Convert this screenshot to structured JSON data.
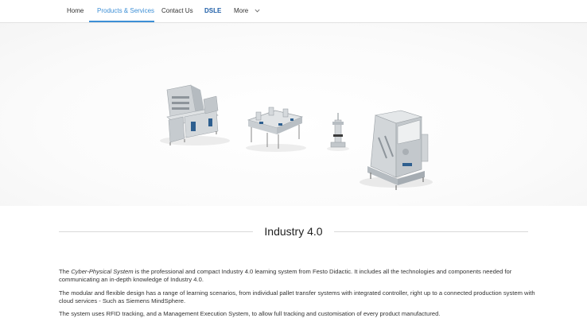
{
  "nav": {
    "items": [
      {
        "label": "Home",
        "active": false
      },
      {
        "label": "Products & Services",
        "active": true
      },
      {
        "label": "Contact Us",
        "active": false
      }
    ],
    "dsle": {
      "part1": "DS",
      "part2": "LE"
    },
    "more_label": "More",
    "more_icon": "chevron-down-icon",
    "accent_color": "#3d8fd6"
  },
  "hero": {
    "image_alt": "Cyber-Physical System production line machines"
  },
  "section": {
    "title": "Industry 4.0"
  },
  "content": {
    "p1_pre": "The ",
    "p1_em": "Cyber-Physical System",
    "p1_post": " is the professional and compact Industry 4.0 learning system from Festo Didactic. It includes all the technologies and components needed for communicating an in-depth knowledge of Industry 4.0.",
    "p2": "The modular and flexible design has a range of learning scenarios, from individual pallet transfer systems with integrated controller, right up to a connected production system with cloud services - Such as Siemens MindSphere.",
    "p3": "The system uses RFID tracking, and a Management Execution System, to allow full tracking and customisation of every product manufactured."
  }
}
